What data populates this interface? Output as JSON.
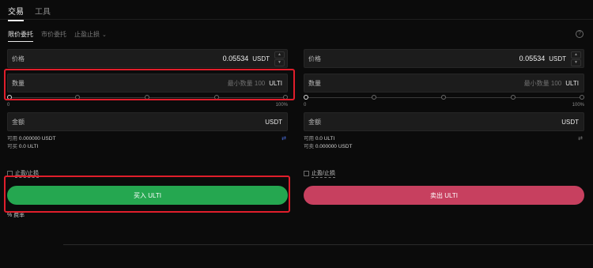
{
  "tabs": [
    "交易",
    "工具"
  ],
  "order_types": [
    "限价委托",
    "市价委托",
    "止盈止损"
  ],
  "buy_panel": {
    "price_label": "价格",
    "price_value": "0.05534",
    "price_unit": "USDT",
    "qty_label": "数量",
    "qty_placeholder": "最小数量 100",
    "qty_unit": "ULTI",
    "slider_min": "0",
    "slider_max": "100%",
    "amount_label": "金额",
    "amount_unit": "USDT",
    "avail_label": "可用",
    "avail_value": "0.000000 USDT",
    "can_label": "可买",
    "can_value": "0.0 ULTI",
    "tpsl_label": "止盈/止损",
    "button": "买入 ULTI",
    "fee_label": "% 费率"
  },
  "sell_panel": {
    "price_label": "价格",
    "price_value": "0.05534",
    "price_unit": "USDT",
    "qty_label": "数量",
    "qty_placeholder": "最小数量 100",
    "qty_unit": "ULTI",
    "slider_min": "0",
    "slider_max": "100%",
    "amount_label": "金额",
    "amount_unit": "USDT",
    "avail_label": "可用",
    "avail_value": "0.0 ULTI",
    "can_label": "可卖",
    "can_value": "0.000000 USDT",
    "tpsl_label": "止盈/止损",
    "button": "卖出 ULTI"
  },
  "colors": {
    "buy": "#25a750",
    "sell": "#c7405f",
    "highlight": "#e01e2b"
  },
  "icons": [
    "info-icon",
    "chevron-down-icon",
    "swap-icon",
    "checkbox-icon"
  ]
}
